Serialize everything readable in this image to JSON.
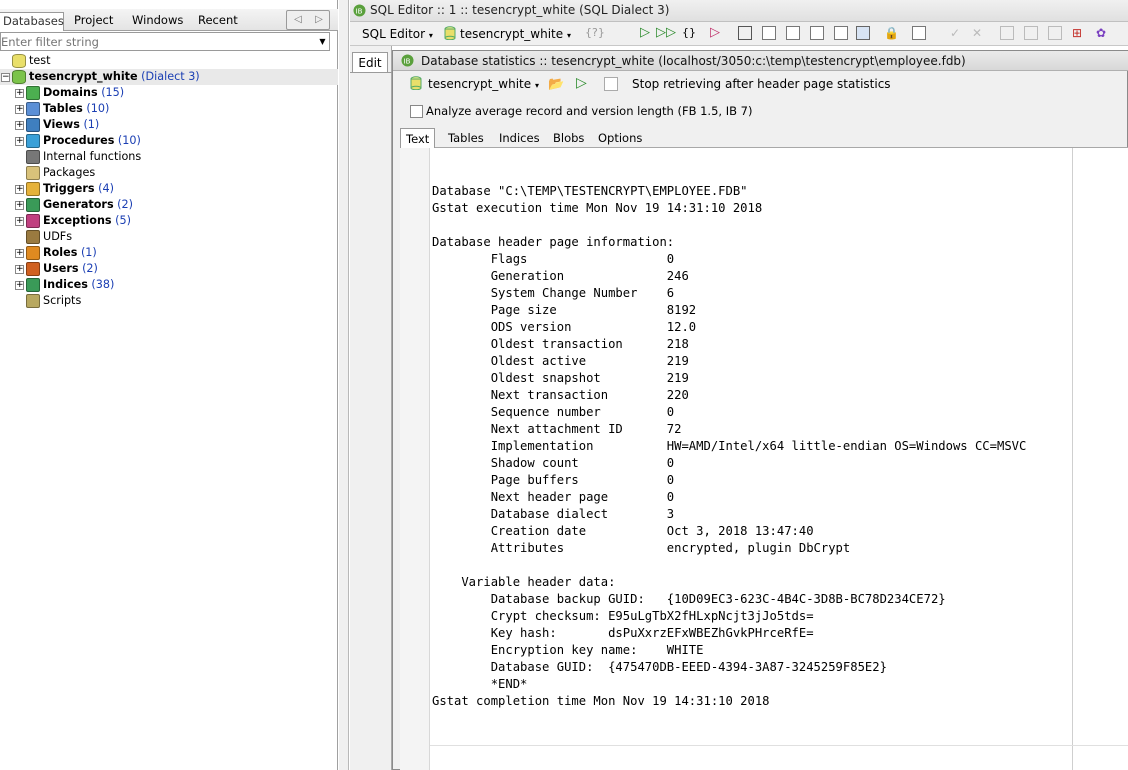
{
  "left": {
    "tabs": [
      "Databases",
      "Project",
      "Windows",
      "Recent"
    ],
    "filter_placeholder": "Enter filter string",
    "tree": [
      {
        "label": "test",
        "count": "",
        "bold": false,
        "expand": "",
        "icon": "database-icon"
      },
      {
        "label": "tesencrypt_white",
        "count": "(Dialect 3)",
        "bold": true,
        "expand": "−",
        "icon": "database-connected-icon"
      },
      {
        "label": "Domains",
        "count": "(15)",
        "bold": true,
        "expand": "+",
        "icon": "domain-icon"
      },
      {
        "label": "Tables",
        "count": "(10)",
        "bold": true,
        "expand": "+",
        "icon": "table-icon"
      },
      {
        "label": "Views",
        "count": "(1)",
        "bold": true,
        "expand": "+",
        "icon": "view-icon"
      },
      {
        "label": "Procedures",
        "count": "(10)",
        "bold": true,
        "expand": "+",
        "icon": "procedure-icon"
      },
      {
        "label": "Internal functions",
        "count": "",
        "bold": false,
        "expand": "",
        "icon": "function-icon"
      },
      {
        "label": "Packages",
        "count": "",
        "bold": false,
        "expand": "",
        "icon": "package-icon"
      },
      {
        "label": "Triggers",
        "count": "(4)",
        "bold": true,
        "expand": "+",
        "icon": "trigger-icon"
      },
      {
        "label": "Generators",
        "count": "(2)",
        "bold": true,
        "expand": "+",
        "icon": "generator-icon"
      },
      {
        "label": "Exceptions",
        "count": "(5)",
        "bold": true,
        "expand": "+",
        "icon": "exception-icon"
      },
      {
        "label": "UDFs",
        "count": "",
        "bold": false,
        "expand": "",
        "icon": "udf-icon"
      },
      {
        "label": "Roles",
        "count": "(1)",
        "bold": true,
        "expand": "+",
        "icon": "role-icon"
      },
      {
        "label": "Users",
        "count": "(2)",
        "bold": true,
        "expand": "+",
        "icon": "user-icon"
      },
      {
        "label": "Indices",
        "count": "(38)",
        "bold": true,
        "expand": "+",
        "icon": "index-icon"
      },
      {
        "label": "Scripts",
        "count": "",
        "bold": false,
        "expand": "",
        "icon": "script-icon"
      }
    ]
  },
  "editor": {
    "title": "SQL Editor :: 1 :: tesencrypt_white (SQL Dialect 3)",
    "menu_label": "SQL Editor",
    "db_selector": "tesencrypt_white",
    "edit_tab": "Edit"
  },
  "stats": {
    "title": "Database statistics :: tesencrypt_white (localhost/3050:c:\\temp\\testencrypt\\employee.fdb)",
    "db_selector": "tesencrypt_white",
    "stop_option": "Stop retrieving after header page statistics",
    "analyze_label": "Analyze average record and version length (FB 1.5, IB 7)",
    "tabs": [
      "Text",
      "Tables",
      "Indices",
      "Blobs",
      "Options"
    ],
    "lines": [
      "Database \"C:\\TEMP\\TESTENCRYPT\\EMPLOYEE.FDB\"",
      "Gstat execution time Mon Nov 19 14:31:10 2018",
      "",
      "Database header page information:",
      "        Flags                   0",
      "        Generation              246",
      "        System Change Number    6",
      "        Page size               8192",
      "        ODS version             12.0",
      "        Oldest transaction      218",
      "        Oldest active           219",
      "        Oldest snapshot         219",
      "        Next transaction        220",
      "        Sequence number         0",
      "        Next attachment ID      72",
      "        Implementation          HW=AMD/Intel/x64 little-endian OS=Windows CC=MSVC",
      "        Shadow count            0",
      "        Page buffers            0",
      "        Next header page        0",
      "        Database dialect        3",
      "        Creation date           Oct 3, 2018 13:47:40",
      "        Attributes              encrypted, plugin DbCrypt",
      "",
      "    Variable header data:",
      "        Database backup GUID:   {10D09EC3-623C-4B4C-3D8B-BC78D234CE72}",
      "        Crypt checksum: E95uLgTbX2fHLxpNcjt3jJo5tds=",
      "        Key hash:       dsPuXxrzEFxWBEZhGvkPHrceRfE=",
      "        Encryption key name:    WHITE",
      "        Database GUID:  {475470DB-EEED-4394-3A87-3245259F85E2}",
      "        *END*",
      "Gstat completion time Mon Nov 19 14:31:10 2018"
    ]
  }
}
